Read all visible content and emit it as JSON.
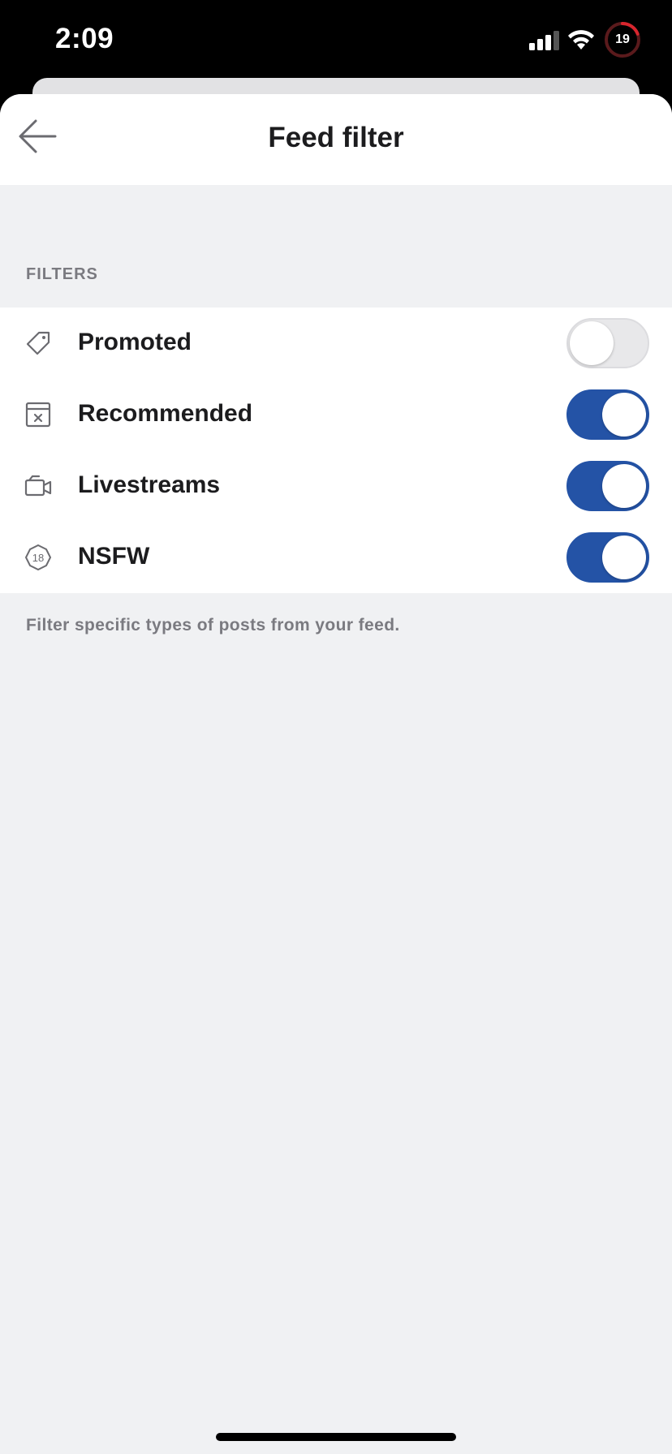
{
  "status_bar": {
    "time": "2:09",
    "battery_level": "19",
    "signal_icon": "cellular-signal-icon",
    "wifi_icon": "wifi-icon",
    "battery_color": "#d8262e"
  },
  "nav": {
    "title": "Feed filter",
    "back_icon": "back-arrow-icon"
  },
  "section": {
    "header": "FILTERS",
    "footer": "Filter specific types of posts from your feed."
  },
  "filters": [
    {
      "label": "Promoted",
      "icon": "tag-icon",
      "enabled": false
    },
    {
      "label": "Recommended",
      "icon": "hide-post-icon",
      "enabled": true
    },
    {
      "label": "Livestreams",
      "icon": "video-camera-icon",
      "enabled": true
    },
    {
      "label": "NSFW",
      "icon": "nsfw-18-icon",
      "enabled": true
    }
  ],
  "colors": {
    "toggle_on": "#2453a6",
    "toggle_off": "#e8e8ea",
    "background": "#f0f1f3"
  }
}
